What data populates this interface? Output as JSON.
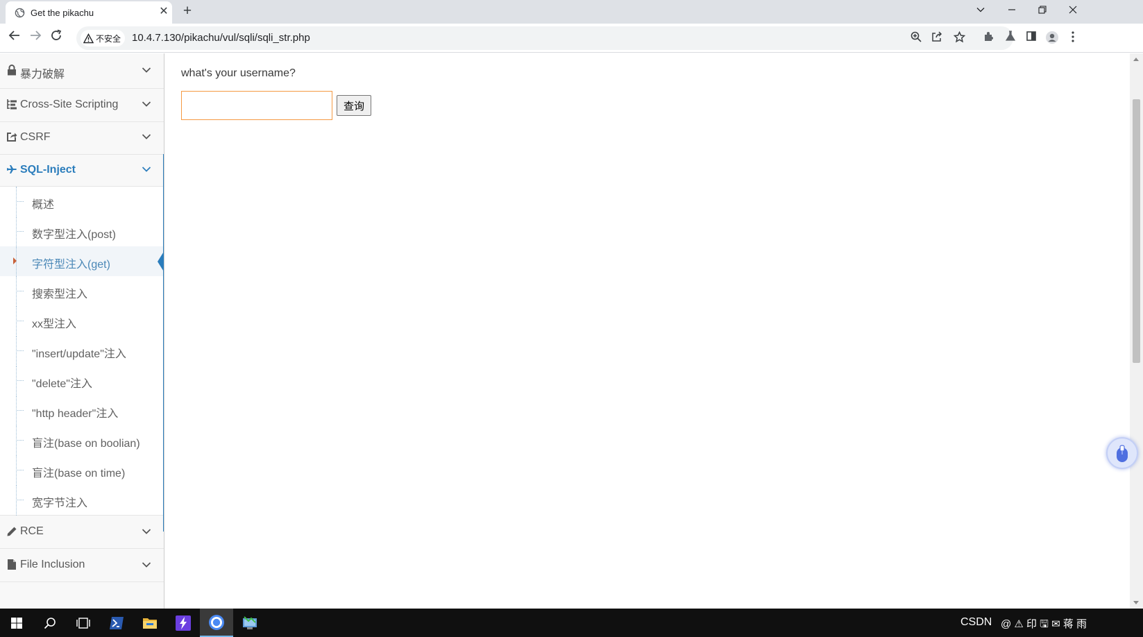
{
  "browser": {
    "tab_title": "Get the pikachu",
    "tab_close_glyph": "✕",
    "new_tab_glyph": "+",
    "security_label": "不安全",
    "url": "10.4.7.130/pikachu/vul/sqli/sqli_str.php",
    "icons": [
      "back-arrow-icon",
      "forward-arrow-icon",
      "reload-icon",
      "warning-icon",
      "zoom-icon",
      "share-icon",
      "bookmark-star-icon",
      "extensions-icon",
      "lab-flask-icon",
      "side-panel-icon",
      "profile-icon",
      "kebab-menu-icon"
    ]
  },
  "sidebar": {
    "menu_top": [
      {
        "label": "暴力破解",
        "icon": "lock-icon"
      },
      {
        "label": "Cross-Site Scripting",
        "icon": "tree-list-icon"
      },
      {
        "label": "CSRF",
        "icon": "share-square-icon"
      }
    ],
    "active_menu": {
      "label": "SQL-Inject",
      "icon": "fighter-jet-icon"
    },
    "sub_items": [
      {
        "label": "概述"
      },
      {
        "label": "数字型注入(post)"
      },
      {
        "label": "字符型注入(get)",
        "current": true
      },
      {
        "label": "搜索型注入"
      },
      {
        "label": "xx型注入"
      },
      {
        "label": "\"insert/update\"注入"
      },
      {
        "label": "\"delete\"注入"
      },
      {
        "label": "\"http header\"注入"
      },
      {
        "label": "盲注(base on boolian)"
      },
      {
        "label": "盲注(base on time)"
      },
      {
        "label": "宽字节注入"
      }
    ],
    "menu_bottom": [
      {
        "label": "RCE",
        "icon": "pencil-icon"
      },
      {
        "label": "File Inclusion",
        "icon": "file-icon"
      }
    ]
  },
  "main": {
    "question": "what's your username?",
    "username_value": "",
    "submit_label": "查询"
  },
  "taskbar": {
    "apps": [
      "windows-start-icon",
      "search-icon",
      "task-view-icon",
      "powershell-icon",
      "file-explorer-icon",
      "visual-studio-icon",
      "chrome-icon",
      "network-tool-icon"
    ],
    "active_app": "chrome-icon",
    "tray_text": "CSDN",
    "tray_glyphs": "@ ⚠ 印 🖫 ✉ 蒋 雨"
  },
  "colors": {
    "accent_blue": "#2b7dbc",
    "input_focus_orange": "#f59942",
    "current_caret": "#c86139"
  }
}
